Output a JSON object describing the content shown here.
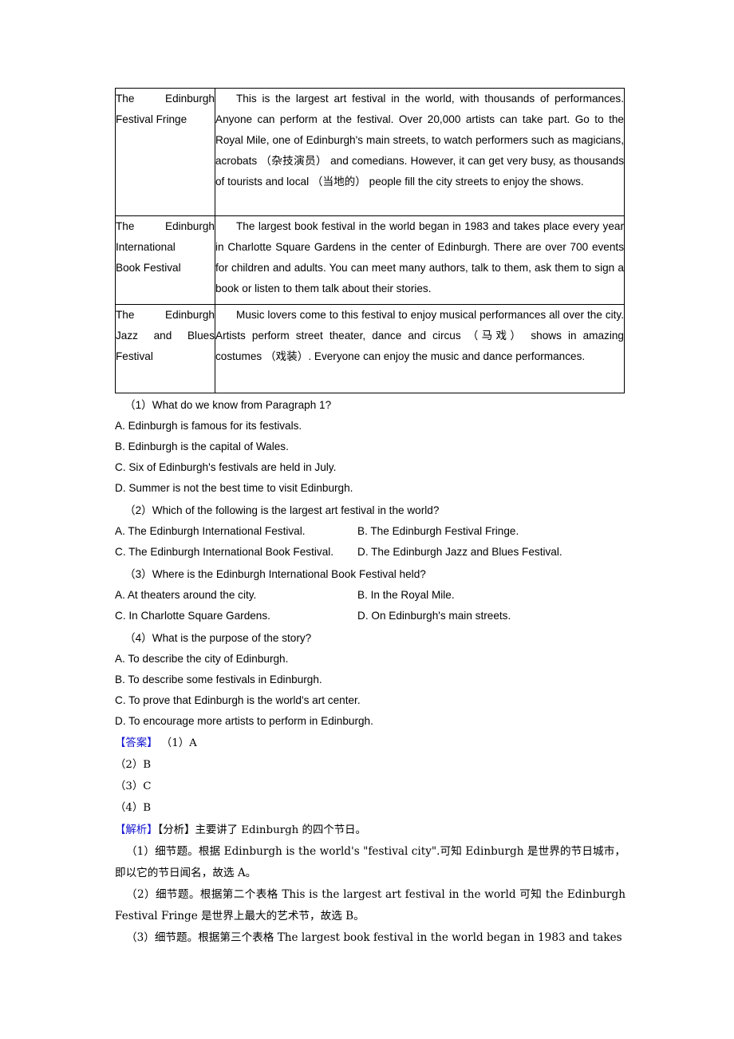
{
  "document": {
    "table": {
      "rows": [
        {
          "name_lines": [
            "The        Edinburgh",
            "Festival Fringe"
          ],
          "name_full": "The Edinburgh Festival Fringe",
          "description": "This is the largest art festival in the world, with thousands of performances. Anyone can perform at the festival. Over 20,000 artists can take part. Go to the Royal Mile, one of Edinburgh's main streets, to watch performers such as magicians, acrobats （杂技演员） and comedians. However, it can get very busy, as thousands of  tourists and local （当地的） people fill the city streets  to enjoy the shows."
        },
        {
          "name_lines": [
            "The        Edinburgh",
            "International",
            "Book   Festival"
          ],
          "name_full": "The Edinburgh International Book Festival",
          "description": "The largest book festival in the world began in 1983 and takes place every year in Charlotte Square Gardens in the center of Edinburgh. There are over 700 events for children and adults. You can meet many authors, talk to them, ask them to sign a book or listen to them talk about their stories."
        },
        {
          "name_lines": [
            "The        Edinburgh",
            "Jazz    and    Blues",
            "Festival"
          ],
          "name_full": "The Edinburgh Jazz and Blues Festival",
          "description": "Music lovers come to this festival to enjoy musical performances all  over the city. Artists perform street theater, dance and circus （马戏） shows in amazing   costumes （戏装）. Everyone can enjoy the music and dance performances."
        }
      ]
    },
    "questions": [
      {
        "stem": "（1）What do we know from Paragraph 1?",
        "options_stacked": [
          "A. Edinburgh is famous for its festivals.",
          "B. Edinburgh is the capital of Wales.",
          "C. Six of Edinburgh's festivals are held in July.",
          "D. Summer is not the best time to visit Edinburgh."
        ],
        "options_paired": []
      },
      {
        "stem": "（2）Which of the following is the largest art festival in the world?",
        "options_stacked": [],
        "options_paired": [
          {
            "left": "A. The Edinburgh International Festival.",
            "right": "B. The Edinburgh Festival Fringe."
          },
          {
            "left": "C. The Edinburgh International Book Festival.",
            "right": "D. The Edinburgh Jazz and Blues Festival."
          }
        ]
      },
      {
        "stem": "（3）Where is the Edinburgh International Book Festival held?",
        "options_stacked": [],
        "options_paired": [
          {
            "left": "A. At theaters around the city.",
            "right": "B. In the Royal Mile."
          },
          {
            "left": "C. In Charlotte Square Gardens.",
            "right": "D. On Edinburgh's main streets."
          }
        ]
      },
      {
        "stem": "（4）What is the purpose of the story?",
        "options_stacked": [
          "A. To describe the city of Edinburgh.",
          "B. To describe some festivals in Edinburgh.",
          "C. To prove that Edinburgh is the world's art center.",
          "D. To encourage more artists to perform in Edinburgh."
        ],
        "options_paired": []
      }
    ],
    "answer_section": {
      "label": "【答案】",
      "label_color": "#1414d2",
      "lines": [
        "（1）A",
        "（2）B",
        "（3）C",
        "（4）B"
      ]
    },
    "explanation_section": {
      "label": "【解析】",
      "label_color": "#1414d2",
      "analysis_label": "【分析】",
      "analysis_text": "主要讲了 Edinburgh 的四个节日。",
      "items": [
        "（1）细节题。根据 Edinburgh is the world's \"festival city\".可知 Edinburgh 是世界的节日城市，即以它的节日闻名，故选 A。",
        "（2）细节题。根据第二个表格 This is the largest art festival in the world 可知 the Edinburgh Festival Fringe 是世界上最大的艺术节，故选 B。",
        "（3）细节题。根据第三个表格 The largest book festival in the world began in 1983 and takes"
      ]
    }
  }
}
